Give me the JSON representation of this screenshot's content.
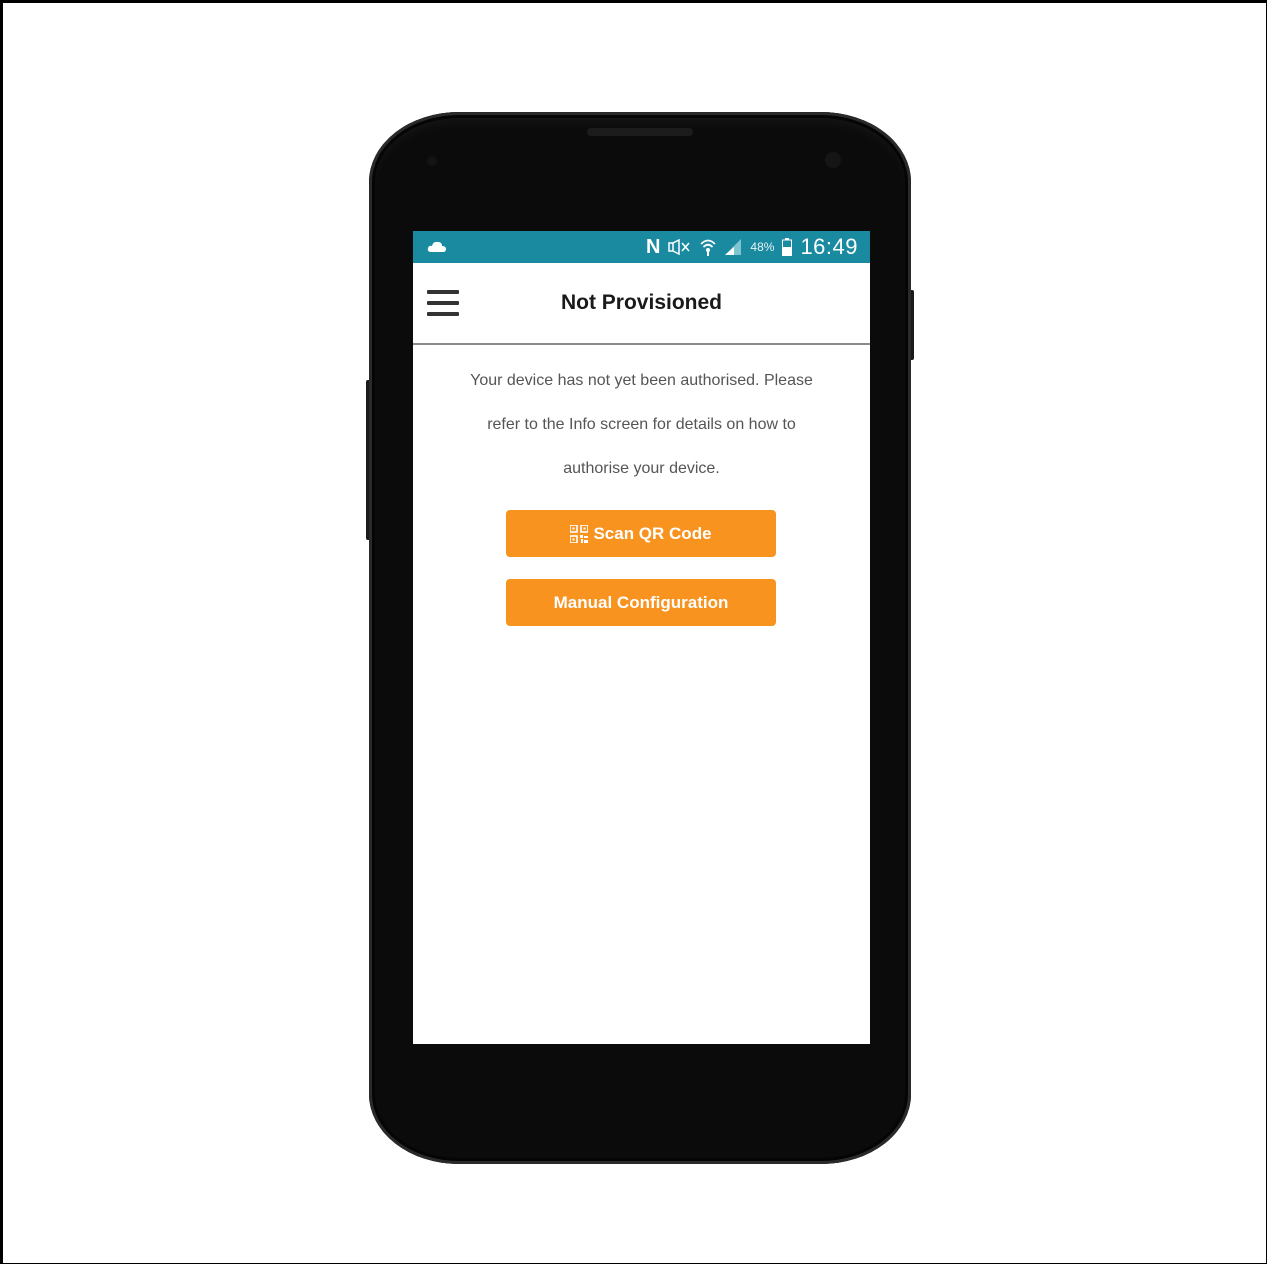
{
  "status_bar": {
    "notification_icon": "cloud-icon",
    "nfc_label": "N",
    "battery_percent": "48%",
    "time": "16:49",
    "background_color": "#1a8aa0"
  },
  "app_bar": {
    "menu_icon": "hamburger-menu-icon",
    "title": "Not Provisioned"
  },
  "main": {
    "message_line1": "Your device has not yet been authorised. Please",
    "message_line2": "refer to the Info screen for details on how to",
    "message_line3": "authorise your device.",
    "scan_button": {
      "icon": "qr-code-icon",
      "label": "Scan QR Code"
    },
    "manual_button": {
      "label": "Manual Configuration"
    },
    "button_color": "#f7931e"
  }
}
